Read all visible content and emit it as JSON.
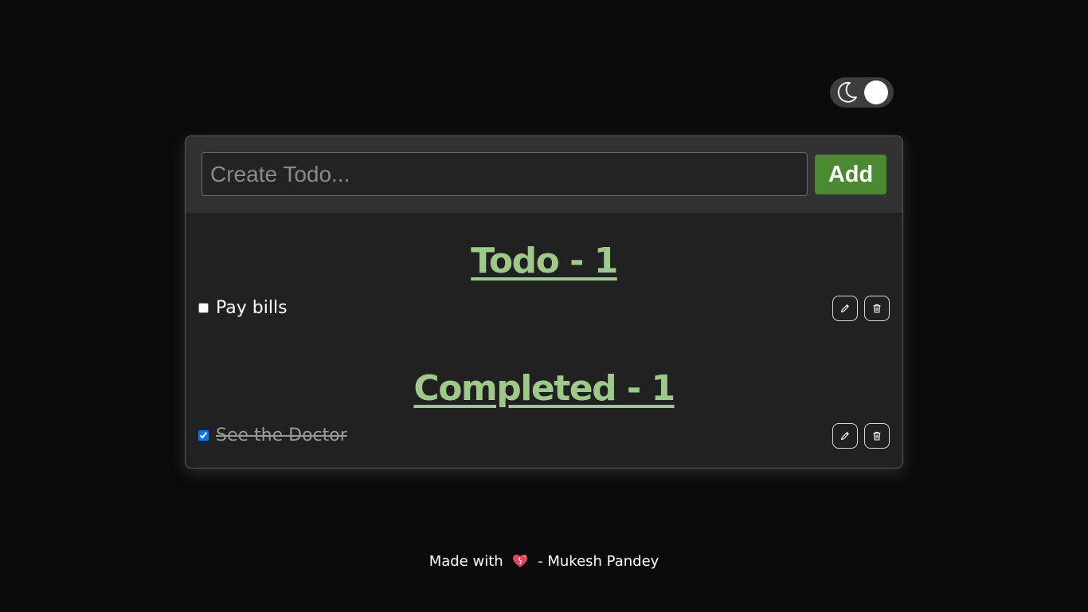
{
  "theme_toggle": {
    "mode": "dark",
    "icon": "moon-icon"
  },
  "create": {
    "placeholder": "Create Todo...",
    "value": "",
    "add_label": "Add"
  },
  "sections": {
    "todo": {
      "heading": "Todo - 1",
      "items": [
        {
          "text": "Pay bills",
          "completed": false,
          "edit_icon": "pencil-icon",
          "delete_icon": "trash-icon"
        }
      ]
    },
    "completed": {
      "heading": "Completed - 1",
      "items": [
        {
          "text": "See the Doctor",
          "completed": true,
          "edit_icon": "pencil-icon",
          "delete_icon": "trash-icon"
        }
      ]
    }
  },
  "footer": {
    "prefix": "Made with",
    "heart_icon": "heart-icon",
    "suffix": "- Mukesh Pandey"
  },
  "colors": {
    "background": "#0b0b0b",
    "card": "#212121",
    "heading": "#9ec98a",
    "add_button": "#4c8a32"
  }
}
